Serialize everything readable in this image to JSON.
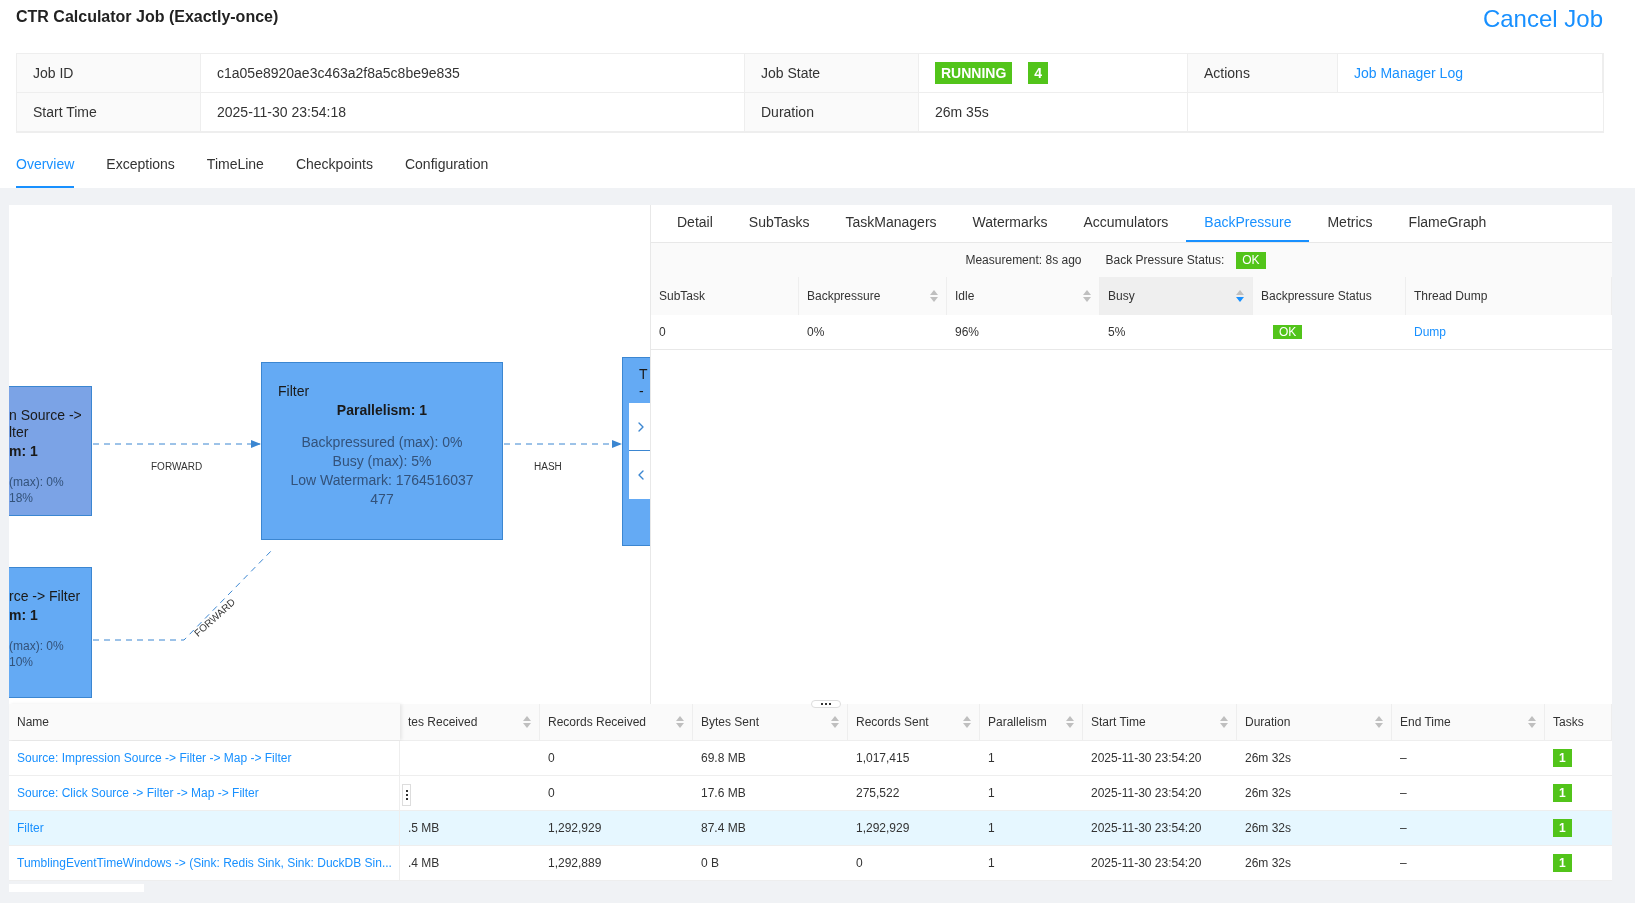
{
  "job": {
    "title": "CTR Calculator Job (Exactly-once)",
    "cancel": "Cancel Job"
  },
  "info": {
    "rows": [
      {
        "cells": [
          {
            "label": "Job ID",
            "value": "c1a05e8920ae3c463a2f8a5c8be9e835",
            "kind": "text"
          },
          {
            "label": "Job State",
            "value": "RUNNING",
            "count": "4",
            "kind": "state"
          },
          {
            "label": "Actions",
            "value": "Job Manager Log",
            "kind": "link"
          }
        ]
      },
      {
        "cells": [
          {
            "label": "Start Time",
            "value": "2025-11-30 23:54:18",
            "kind": "text"
          },
          {
            "label": "Duration",
            "value": "26m 35s",
            "kind": "text"
          }
        ]
      }
    ]
  },
  "tabs": [
    {
      "label": "Overview",
      "selected": true
    },
    {
      "label": "Exceptions",
      "selected": false
    },
    {
      "label": "TimeLine",
      "selected": false
    },
    {
      "label": "Checkpoints",
      "selected": false
    },
    {
      "label": "Configuration",
      "selected": false
    }
  ],
  "graph": {
    "nodes": [
      {
        "title": [
          "n Source ->",
          "lter"
        ],
        "parallelism": "m: 1",
        "metrics": [
          "(max): 0%",
          "18%"
        ],
        "color": "#7ba3e6",
        "kind": "clipped-left"
      },
      {
        "title": [
          "Filter"
        ],
        "parallelism": "Parallelism: 1",
        "metrics": [
          "Backpressured (max): 0%",
          "Busy (max): 5%",
          "Low Watermark: 1764516037",
          "477"
        ],
        "color": "#64aaf4",
        "kind": "full"
      },
      {
        "title": [
          "T",
          "-"
        ],
        "color": "#64aaf4",
        "kind": "clipped-right"
      },
      {
        "title": [
          "rce -> Filter"
        ],
        "parallelism": "m: 1",
        "metrics": [
          "(max): 0%",
          "10%"
        ],
        "color": "#64aaf4",
        "kind": "clipped-left"
      }
    ],
    "edges": [
      {
        "label": "FORWARD"
      },
      {
        "label": "HASH"
      },
      {
        "label": "FORWARD"
      }
    ]
  },
  "detail": {
    "tabs": [
      {
        "label": "Detail",
        "selected": false
      },
      {
        "label": "SubTasks",
        "selected": false
      },
      {
        "label": "TaskManagers",
        "selected": false
      },
      {
        "label": "Watermarks",
        "selected": false
      },
      {
        "label": "Accumulators",
        "selected": false
      },
      {
        "label": "BackPressure",
        "selected": true
      },
      {
        "label": "Metrics",
        "selected": false
      },
      {
        "label": "FlameGraph",
        "selected": false
      }
    ],
    "measurement": "Measurement: 8s ago",
    "status_label": "Back Pressure Status:",
    "status": "OK",
    "columns": [
      {
        "label": "SubTask",
        "sortable": false
      },
      {
        "label": "Backpressure",
        "sortable": true,
        "sorted": false
      },
      {
        "label": "Idle",
        "sortable": true,
        "sorted": false
      },
      {
        "label": "Busy",
        "sortable": true,
        "sorted": true
      },
      {
        "label": "Backpressure Status",
        "sortable": false
      },
      {
        "label": "Thread Dump",
        "sortable": false
      }
    ],
    "rows": [
      {
        "subtask": "0",
        "backpressure": "0%",
        "idle": "96%",
        "busy": "5%",
        "status": "OK",
        "dump": "Dump"
      }
    ]
  },
  "vertices": {
    "columns": [
      {
        "label": "Name",
        "sortable": false
      },
      {
        "label": "tes Received",
        "sortable": true
      },
      {
        "label": "Records Received",
        "sortable": true
      },
      {
        "label": "Bytes Sent",
        "sortable": true
      },
      {
        "label": "Records Sent",
        "sortable": true
      },
      {
        "label": "Parallelism",
        "sortable": true
      },
      {
        "label": "Start Time",
        "sortable": true
      },
      {
        "label": "Duration",
        "sortable": true
      },
      {
        "label": "End Time",
        "sortable": true
      },
      {
        "label": "Tasks",
        "sortable": false
      }
    ],
    "rows": [
      {
        "selected": false,
        "cells": [
          "Source: Impression Source -> Filter -> Map -> Filter",
          null,
          "0",
          "69.8 MB",
          "1,017,415",
          "1",
          "2025-11-30 23:54:20",
          "26m 32s",
          "–",
          "1"
        ]
      },
      {
        "selected": false,
        "cells": [
          "Source: Click Source -> Filter -> Map -> Filter",
          null,
          "0",
          "17.6 MB",
          "275,522",
          "1",
          "2025-11-30 23:54:20",
          "26m 32s",
          "–",
          "1"
        ]
      },
      {
        "selected": true,
        "cells": [
          "Filter",
          ".5 MB",
          "1,292,929",
          "87.4 MB",
          "1,292,929",
          "1",
          "2025-11-30 23:54:20",
          "26m 32s",
          "–",
          "1"
        ]
      },
      {
        "selected": false,
        "cells": [
          "TumblingEventTimeWindows -> (Sink: Redis Sink, Sink: DuckDB Sin...",
          ".4 MB",
          "1,292,889",
          "0 B",
          "0",
          "1",
          "2025-11-30 23:54:20",
          "26m 32s",
          "–",
          "1"
        ]
      }
    ]
  }
}
